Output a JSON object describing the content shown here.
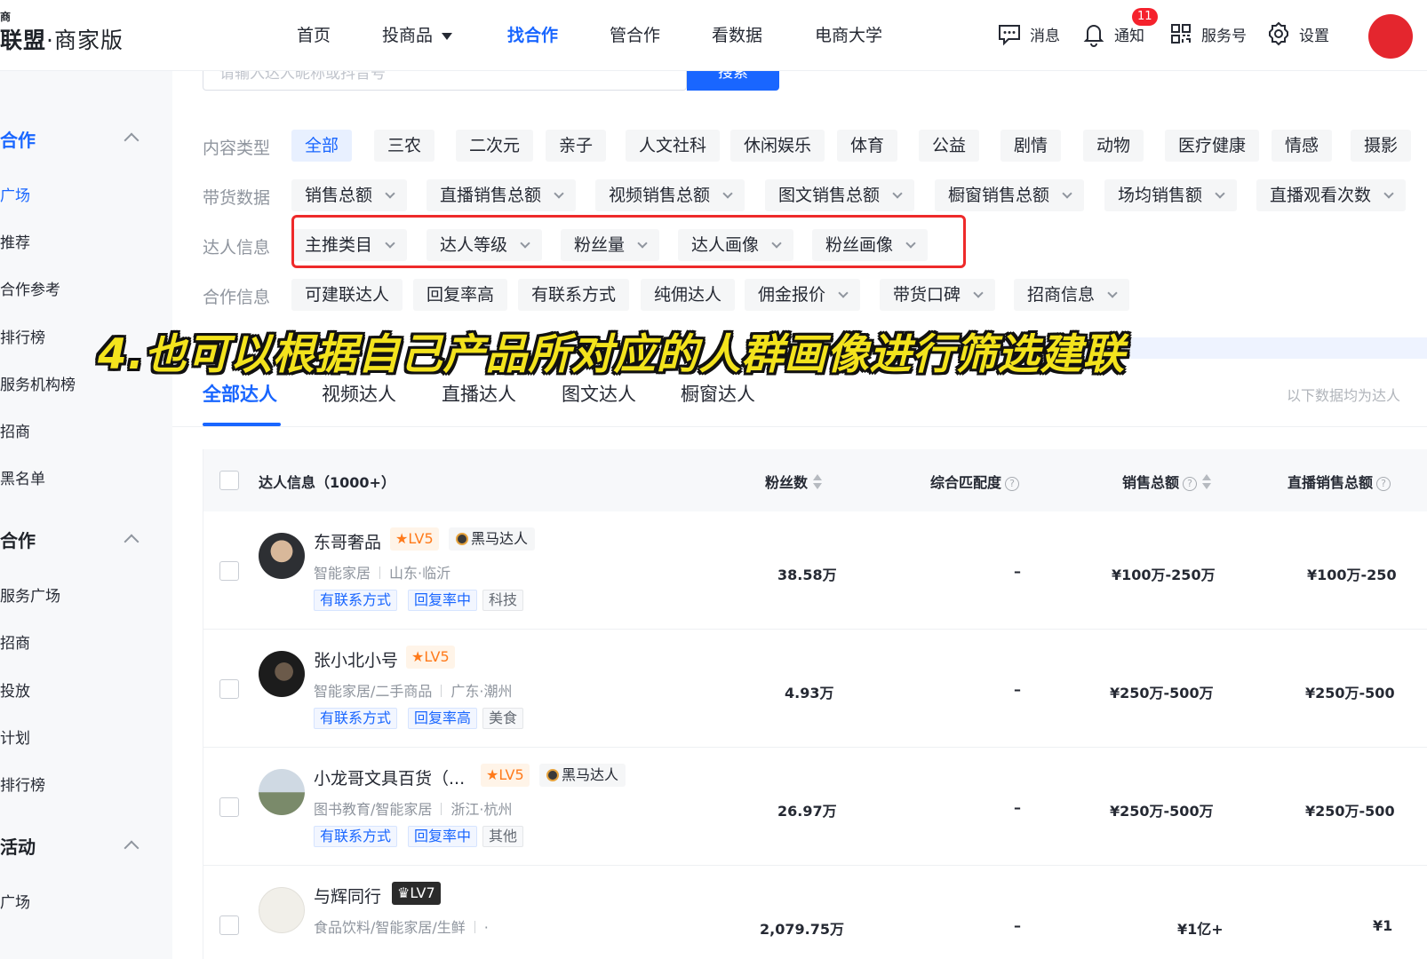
{
  "brand": {
    "top_fragment": "商",
    "name": "联盟",
    "suffix": "·商家版"
  },
  "nav": {
    "items": [
      "首页",
      "投商品",
      "找合作",
      "管合作",
      "看数据",
      "电商大学"
    ],
    "active": "找合作",
    "tools": {
      "message": "消息",
      "notify": "通知",
      "notify_count": "11",
      "service": "服务号",
      "settings": "设置"
    }
  },
  "sidebar": {
    "groups": [
      {
        "title": "合作",
        "items": [
          "广场",
          "推荐",
          "合作参考",
          "排行榜",
          "服务机构榜",
          "招商",
          "黑名单"
        ]
      },
      {
        "title": "合作",
        "items": [
          "服务广场",
          "招商",
          "投放",
          "计划",
          "排行榜"
        ]
      },
      {
        "title": "活动",
        "items": [
          "广场"
        ]
      }
    ]
  },
  "search": {
    "placeholder": "请输入达人昵称或抖音号",
    "button": "搜索"
  },
  "filters": {
    "content_type": {
      "label": "内容类型",
      "chips": [
        "全部",
        "三农",
        "二次元",
        "亲子",
        "人文社科",
        "休闲娱乐",
        "体育",
        "公益",
        "剧情",
        "动物",
        "医疗健康",
        "情感",
        "摄影"
      ]
    },
    "sales_data": {
      "label": "带货数据",
      "chips": [
        "销售总额",
        "直播销售总额",
        "视频销售总额",
        "图文销售总额",
        "橱窗销售总额",
        "场均销售额",
        "直播观看次数"
      ]
    },
    "creator_info": {
      "label": "达人信息",
      "chips": [
        "主推类目",
        "达人等级",
        "粉丝量",
        "达人画像",
        "粉丝画像"
      ]
    },
    "coop_info": {
      "label": "合作信息",
      "chips": [
        "可建联达人",
        "回复率高",
        "有联系方式",
        "纯佣达人",
        "佣金报价",
        "带货口碑",
        "招商信息"
      ]
    }
  },
  "caption": "4.也可以根据自己产品所对应的人群画像进行筛选建联",
  "tabs": {
    "items": [
      "全部达人",
      "视频达人",
      "直播达人",
      "图文达人",
      "橱窗达人"
    ],
    "active": "全部达人",
    "note": "以下数据均为达人"
  },
  "table": {
    "headers": {
      "info": "达人信息（1000+）",
      "fans": "粉丝数",
      "match": "综合匹配度",
      "sales": "销售总额",
      "live_sales": "直播销售总额"
    },
    "rows": [
      {
        "name": "东哥奢品",
        "level": "LV5",
        "badge": "黑马达人",
        "category": "智能家居",
        "location": "山东·临沂",
        "tags": [
          "有联系方式",
          "回复率中",
          "科技"
        ],
        "fans": "38.58万",
        "match": "–",
        "sales": "¥100万-250万",
        "live_sales": "¥100万-250"
      },
      {
        "name": "张小北小号",
        "level": "LV5",
        "badge": "",
        "category": "智能家居/二手商品",
        "location": "广东·潮州",
        "tags": [
          "有联系方式",
          "回复率高",
          "美食"
        ],
        "fans": "4.93万",
        "match": "–",
        "sales": "¥250万-500万",
        "live_sales": "¥250万-500"
      },
      {
        "name": "小龙哥文具百货（...",
        "level": "LV5",
        "badge": "黑马达人",
        "category": "图书教育/智能家居",
        "location": "浙江·杭州",
        "tags": [
          "有联系方式",
          "回复率中",
          "其他"
        ],
        "fans": "26.97万",
        "match": "–",
        "sales": "¥250万-500万",
        "live_sales": "¥250万-500"
      },
      {
        "name": "与辉同行",
        "level": "LV7",
        "badge": "",
        "category": "食品饮料/智能家居/生鲜",
        "location": "·",
        "tags": [],
        "fans": "2,079.75万",
        "match": "–",
        "sales": "¥1亿+",
        "live_sales": "¥1"
      }
    ]
  },
  "colors": {
    "accent": "#1966ff",
    "highlight": "#ee2a2a",
    "caption": "#f3e31d",
    "level": "#ff7a1a"
  }
}
